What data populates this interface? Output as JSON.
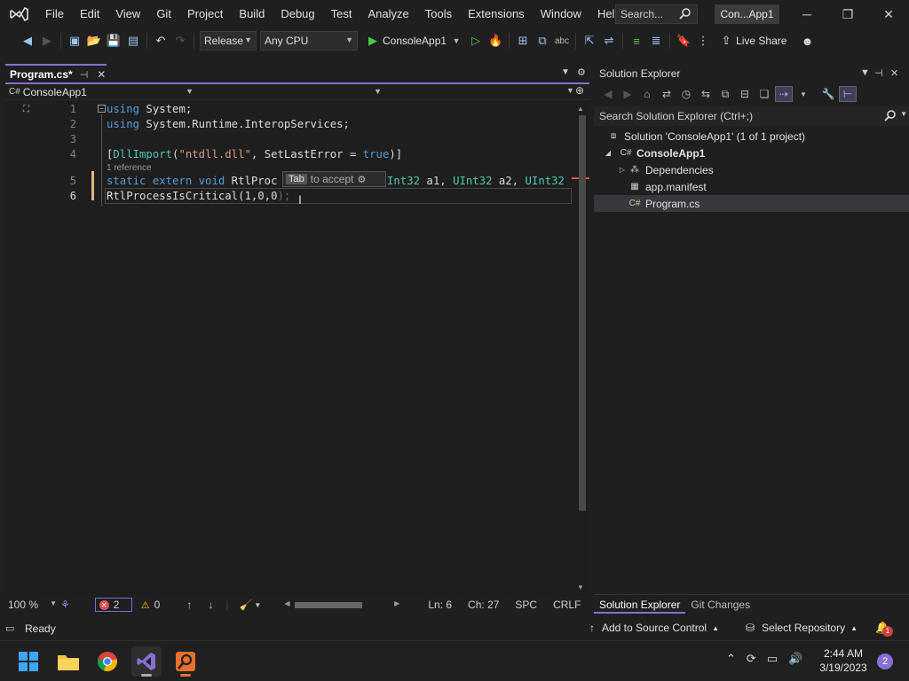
{
  "menubar": {
    "items": [
      "File",
      "Edit",
      "View",
      "Git",
      "Project",
      "Build",
      "Debug",
      "Test",
      "Analyze",
      "Tools",
      "Extensions",
      "Window",
      "Help"
    ],
    "search_placeholder": "Search...",
    "title_badge": "Con...App1"
  },
  "toolbar": {
    "configuration": "Release",
    "platform": "Any CPU",
    "run_target": "ConsoleApp1",
    "live_share_label": "Live Share"
  },
  "editor": {
    "tab_label": "Program.cs*",
    "nav_project": "ConsoleApp1",
    "line_numbers": [
      "1",
      "2",
      "3",
      "4",
      "5",
      "6"
    ],
    "lines": {
      "l1_kw": "using",
      "l1_ns": " System;",
      "l2_kw": "using",
      "l2_ns": " System.Runtime.InteropServices;",
      "l4_open": "[",
      "l4_attr": "DllImport",
      "l4_p1": "(",
      "l4_str": "\"ntdll.dll\"",
      "l4_p2": ", SetLastError = ",
      "l4_true": "true",
      "l4_close": ")]",
      "l5_kw": "static extern void",
      "l5_name": " RtlProc",
      "l5_rest_t1": "Int32",
      "l5_rest_a1": " a1, ",
      "l5_rest_t2": "UInt32",
      "l5_rest_a2": " a2, ",
      "l5_rest_t3": "UInt32",
      "l6_code": "RtlProcessIsCritical(1,0,0",
      "l6_ghost": ");"
    },
    "reference_lens": "1 reference",
    "suggestion_key": "Tab",
    "suggestion_text": "to accept"
  },
  "editor_status": {
    "zoom": "100 %",
    "errors": "2",
    "warnings": "0",
    "line": "Ln: 6",
    "char": "Ch: 27",
    "indent": "SPC",
    "eol": "CRLF"
  },
  "solution_explorer": {
    "title": "Solution Explorer",
    "search_placeholder": "Search Solution Explorer (Ctrl+;)",
    "tree": {
      "solution": "Solution 'ConsoleApp1' (1 of 1 project)",
      "project": "ConsoleApp1",
      "dependencies": "Dependencies",
      "manifest": "app.manifest",
      "program": "Program.cs"
    },
    "tabs": [
      "Solution Explorer",
      "Git Changes"
    ]
  },
  "statusbar": {
    "ready": "Ready",
    "add_source_control": "Add to Source Control",
    "select_repository": "Select Repository",
    "notifications": "1"
  },
  "taskbar": {
    "time": "2:44 AM",
    "date": "3/19/2023",
    "notification_count": "2"
  },
  "colors": {
    "accent": "#8a6ed6",
    "keyword": "#569cd6",
    "type": "#4ec9b0",
    "string": "#d69d85",
    "error": "#e05050"
  }
}
